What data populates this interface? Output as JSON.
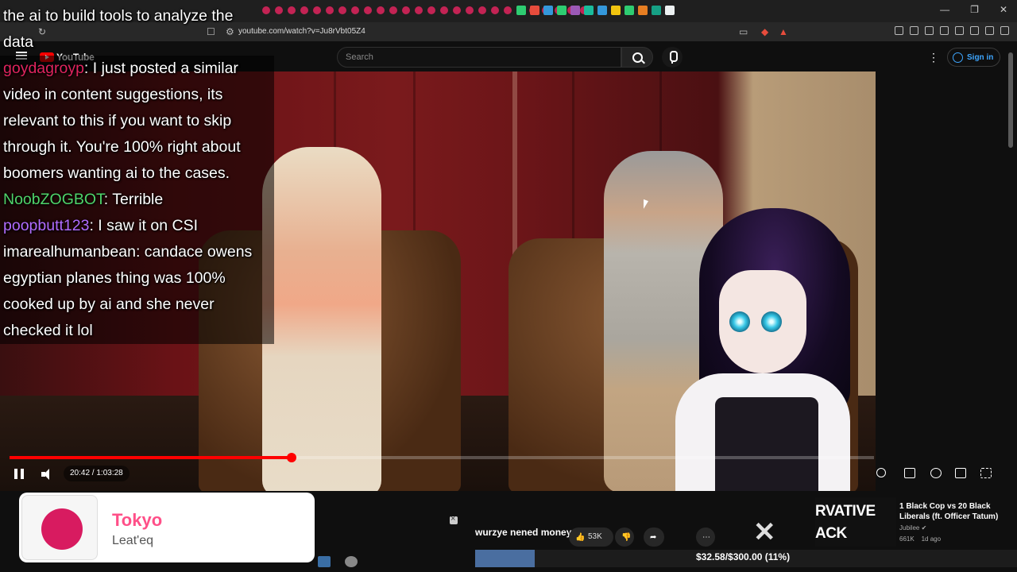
{
  "browser": {
    "url": "youtube.com/watch?v=Ju8rVbt05Z4"
  },
  "youtube": {
    "logo_text": "YouTube",
    "search_placeholder": "Search",
    "signin_label": "Sign in",
    "kebab_glyph": "⋮"
  },
  "overlay": {
    "title_text": "the ai to build tools to analyze the data"
  },
  "chat": {
    "messages": [
      {
        "user": "goydagroyp",
        "user_color": "#e0245e",
        "text": ": I just posted a similar video in content suggestions, its relevant to this if you want to skip through it. You're 100% right about boomers wanting ai to the cases."
      },
      {
        "user": "NoobZOGBOT",
        "user_color": "#4fd46a",
        "text": ": Terrible"
      },
      {
        "user": "poopbutt123",
        "user_color": "#b06cff",
        "text": ": I saw it on CSI"
      },
      {
        "user": "imarealhumanbean",
        "user_color": "#ffffff",
        "text": ": candace owens egyptian planes thing was 100% cooked up by ai and she never checked it lol"
      }
    ]
  },
  "player": {
    "time_current": "20:42",
    "time_separator": " / ",
    "time_total": "1:03:28",
    "progress_fraction": 0.3262
  },
  "notification": {
    "title": "Tokyo",
    "subtitle": "Leat'eq"
  },
  "actions": {
    "label": "wurzye nened money",
    "like_count": "53K"
  },
  "recommended": {
    "thumb_text_line1": "RVATIVE",
    "thumb_text_line2": "ACK LIBERALS",
    "title": "1 Black Cop vs 20 Black Liberals (ft. Officer Tatum)",
    "channel": "Jubilee",
    "views": "661K",
    "age": "1d ago"
  },
  "goal": {
    "text": "$32.58/$300.00 (11%)",
    "fraction": 0.11
  },
  "colors": {
    "accent": "#ff0000",
    "link_blue": "#3ea6ff",
    "notif_pink": "#ff4f88"
  }
}
